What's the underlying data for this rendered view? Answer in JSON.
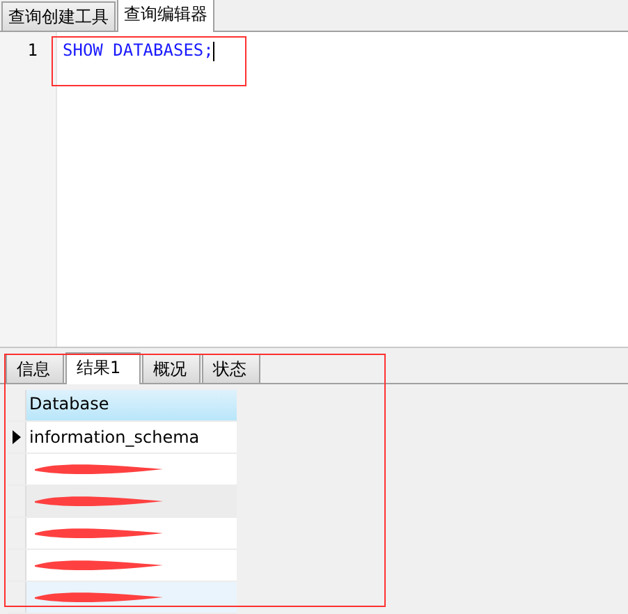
{
  "tabs": [
    {
      "label": "查询创建工具",
      "selected": false
    },
    {
      "label": "查询编辑器",
      "selected": true
    }
  ],
  "editor": {
    "outlined": true,
    "lines": [
      {
        "number": "1",
        "code": "SHOW DATABASES;",
        "cursor": true
      }
    ]
  },
  "result_tabs": [
    {
      "label": "信息",
      "selected": false
    },
    {
      "label": "结果1",
      "selected": true
    },
    {
      "label": "概况",
      "selected": false
    },
    {
      "label": "状态",
      "selected": false
    }
  ],
  "results": {
    "outlined": true,
    "columns": [
      "Database"
    ],
    "rows": [
      {
        "kind": "text",
        "cells": [
          "information_schema"
        ],
        "current": true,
        "color": "#ffffff"
      },
      {
        "kind": "redacted",
        "current": false,
        "color": "#ffffff"
      },
      {
        "kind": "redacted",
        "current": false,
        "color": "#ececec"
      },
      {
        "kind": "redacted",
        "current": false,
        "color": "#ffffff"
      },
      {
        "kind": "redacted",
        "current": false,
        "color": "#ffffff"
      },
      {
        "kind": "redacted",
        "current": false,
        "color": "#eaf4fc"
      }
    ]
  }
}
